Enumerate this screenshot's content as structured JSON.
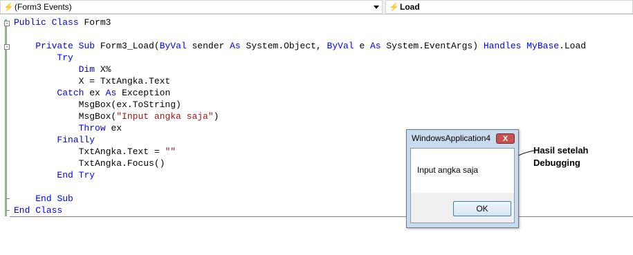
{
  "toolbar": {
    "left_dropdown": {
      "value": "(Form3 Events)",
      "icon": "lightning-icon"
    },
    "right_dropdown": {
      "value": "Load",
      "icon": "lightning-icon"
    }
  },
  "code": {
    "lines": [
      [
        {
          "t": "Public",
          "k": "kw"
        },
        {
          "t": " "
        },
        {
          "t": "Class",
          "k": "kw"
        },
        {
          "t": " Form3"
        }
      ],
      [],
      [
        {
          "t": "    "
        },
        {
          "t": "Private",
          "k": "kw"
        },
        {
          "t": " "
        },
        {
          "t": "Sub",
          "k": "kw"
        },
        {
          "t": " Form3_Load("
        },
        {
          "t": "ByVal",
          "k": "kw"
        },
        {
          "t": " sender "
        },
        {
          "t": "As",
          "k": "kw"
        },
        {
          "t": " System.Object, "
        },
        {
          "t": "ByVal",
          "k": "kw"
        },
        {
          "t": " e "
        },
        {
          "t": "As",
          "k": "kw"
        },
        {
          "t": " System.EventArgs) "
        },
        {
          "t": "Handles",
          "k": "kw"
        },
        {
          "t": " "
        },
        {
          "t": "MyBase",
          "k": "kw"
        },
        {
          "t": ".Load"
        }
      ],
      [
        {
          "t": "        "
        },
        {
          "t": "Try",
          "k": "kw"
        }
      ],
      [
        {
          "t": "            "
        },
        {
          "t": "Dim",
          "k": "kw"
        },
        {
          "t": " X%"
        }
      ],
      [
        {
          "t": "            X = TxtAngka.Text"
        }
      ],
      [
        {
          "t": "        "
        },
        {
          "t": "Catch",
          "k": "kw"
        },
        {
          "t": " ex "
        },
        {
          "t": "As",
          "k": "kw"
        },
        {
          "t": " Exception"
        }
      ],
      [
        {
          "t": "            MsgBox(ex.ToString)"
        }
      ],
      [
        {
          "t": "            MsgBox("
        },
        {
          "t": "\"Input angka saja\"",
          "k": "str"
        },
        {
          "t": ")"
        }
      ],
      [
        {
          "t": "            "
        },
        {
          "t": "Throw",
          "k": "kw"
        },
        {
          "t": " ex"
        }
      ],
      [
        {
          "t": "        "
        },
        {
          "t": "Finally",
          "k": "kw"
        }
      ],
      [
        {
          "t": "            TxtAngka.Text = "
        },
        {
          "t": "\"\"",
          "k": "str"
        }
      ],
      [
        {
          "t": "            TxtAngka.Focus()"
        }
      ],
      [
        {
          "t": "        "
        },
        {
          "t": "End",
          "k": "kw"
        },
        {
          "t": " "
        },
        {
          "t": "Try",
          "k": "kw"
        }
      ],
      [],
      [
        {
          "t": "    "
        },
        {
          "t": "End",
          "k": "kw"
        },
        {
          "t": " "
        },
        {
          "t": "Sub",
          "k": "kw"
        }
      ],
      [
        {
          "t": "End",
          "k": "kw"
        },
        {
          "t": " "
        },
        {
          "t": "Class",
          "k": "kw"
        }
      ]
    ]
  },
  "dialog": {
    "title": "WindowsApplication4",
    "close_label": "X",
    "message": "Input angka saja",
    "ok_label": "OK"
  },
  "annotation": {
    "line1": "Hasil setelah",
    "line2": "Debugging"
  },
  "colors": {
    "keyword": "#0000ff",
    "string": "#a31515",
    "change_bar": "#80c080"
  }
}
